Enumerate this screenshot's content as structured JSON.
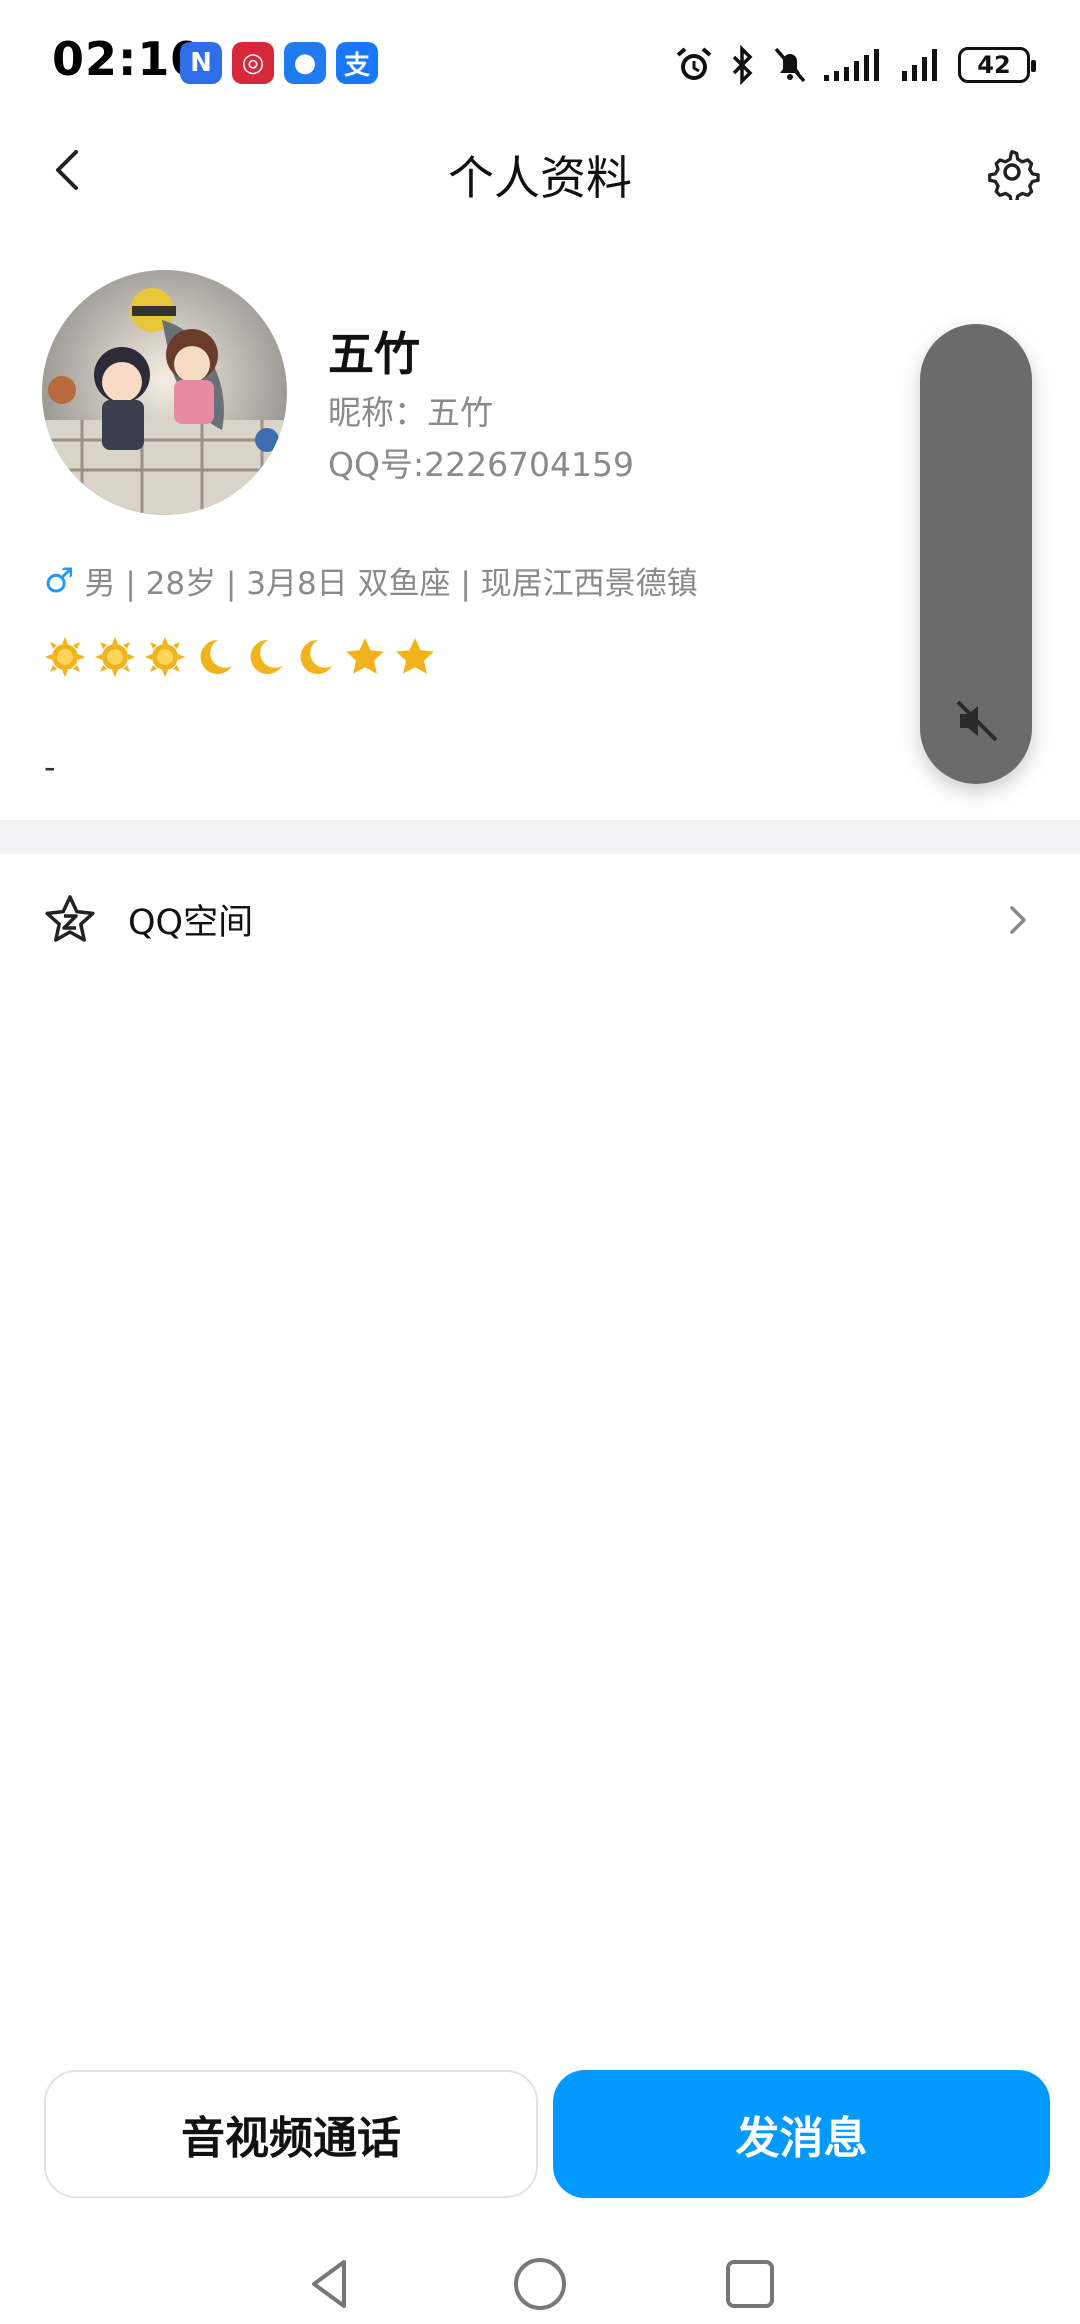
{
  "status_bar": {
    "time": "02:10",
    "app_badges": [
      {
        "icon": "nfc-icon",
        "glyph": "N",
        "color": "#2f6ee8"
      },
      {
        "icon": "bank-icon",
        "glyph": "◎",
        "color": "#d6283a"
      },
      {
        "icon": "message-icon",
        "glyph": "●",
        "color": "#1e7bf2"
      },
      {
        "icon": "alipay-icon",
        "glyph": "支",
        "color": "#1677ff"
      }
    ],
    "battery": "42"
  },
  "header": {
    "title": "个人资料"
  },
  "profile": {
    "name": "五竹",
    "nickname_label": "昵称：",
    "nickname": "五竹",
    "qq_label": "QQ号:",
    "qq_number": "2226704159",
    "gender_symbol": "♂",
    "info_line": "男 | 28岁 | 3月8日 双鱼座 | 现居江西景德镇",
    "levels": [
      "sun",
      "sun",
      "sun",
      "moon",
      "moon",
      "moon",
      "star",
      "star"
    ],
    "signature": "-"
  },
  "qzone": {
    "label": "QQ空间"
  },
  "actions": {
    "call_label": "音视频通话",
    "message_label": "发消息"
  },
  "colors": {
    "accent": "#0099ff",
    "band": "#f2f2f5",
    "secondary_text": "#8a8a8a",
    "mute_pill": "#6b6b6b"
  }
}
